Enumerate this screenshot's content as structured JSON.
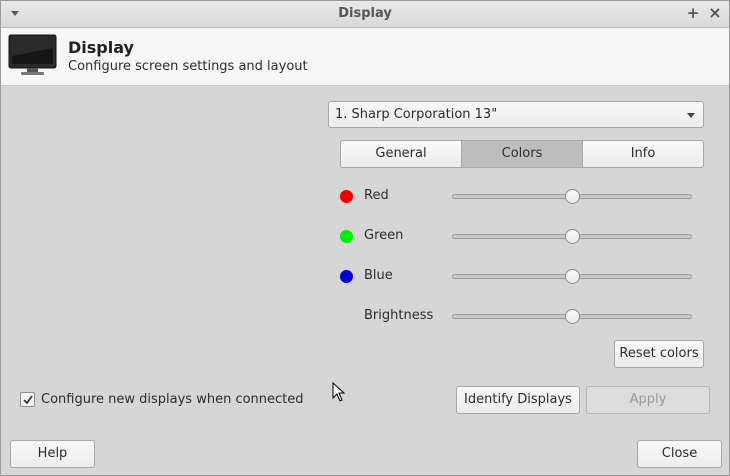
{
  "window": {
    "title": "Display"
  },
  "header": {
    "title": "Display",
    "subtitle": "Configure screen settings and layout",
    "icon": "monitor-icon"
  },
  "display_select": {
    "value": "1. Sharp Corporation 13\""
  },
  "tabs": [
    {
      "label": "General",
      "active": false
    },
    {
      "label": "Colors",
      "active": true
    },
    {
      "label": "Info",
      "active": false
    }
  ],
  "colors": {
    "red": {
      "label": "Red",
      "dot": "#ee0000",
      "value": 0.5
    },
    "green": {
      "label": "Green",
      "dot": "#00ee00",
      "value": 0.5
    },
    "blue": {
      "label": "Blue",
      "dot": "#0000dd",
      "value": 0.5
    },
    "brightness": {
      "label": "Brightness",
      "value": 0.5
    }
  },
  "buttons": {
    "reset": "Reset colors",
    "identify": "Identify Displays",
    "apply": "Apply",
    "help": "Help",
    "close": "Close"
  },
  "auto_configure": {
    "label": "Configure new displays when connected",
    "checked": true
  }
}
